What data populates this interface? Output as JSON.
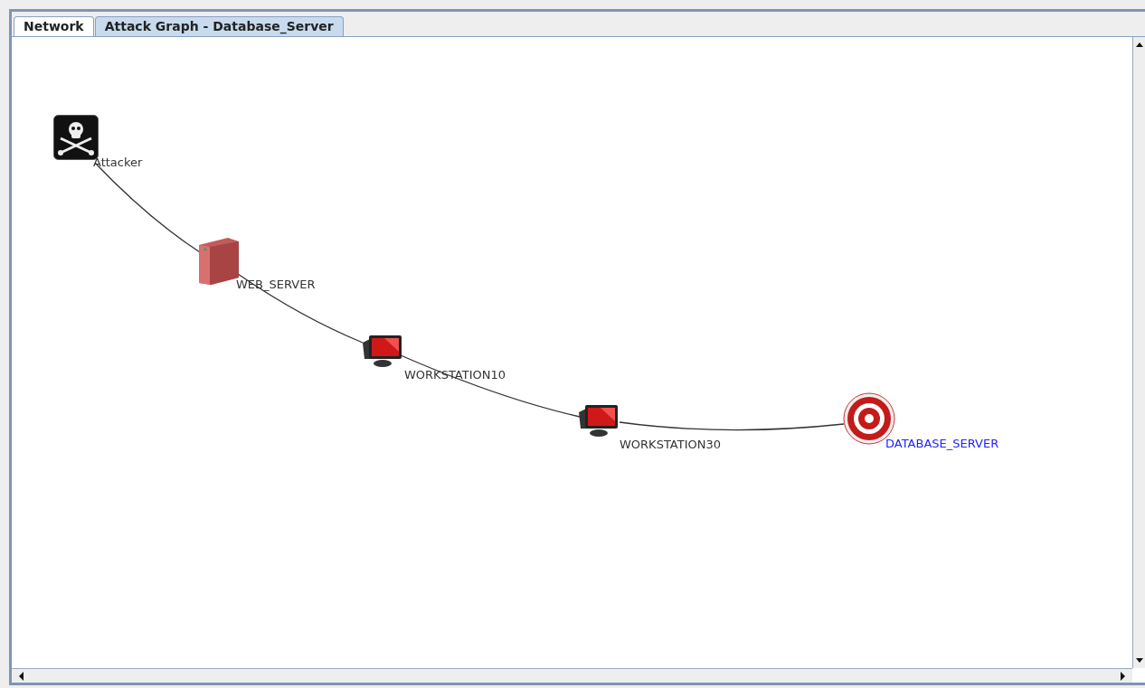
{
  "tabs": [
    {
      "label": "Network",
      "selected": false
    },
    {
      "label": "Attack Graph - Database_Server",
      "selected": true
    }
  ],
  "graph": {
    "nodes": [
      {
        "kind": "attacker",
        "label": "Attacker"
      },
      {
        "kind": "server",
        "label": "WEB_SERVER"
      },
      {
        "kind": "workstation",
        "label": "WORKSTATION10"
      },
      {
        "kind": "workstation",
        "label": "WORKSTATION30"
      },
      {
        "kind": "target",
        "label": "DATABASE_SERVER"
      }
    ]
  }
}
